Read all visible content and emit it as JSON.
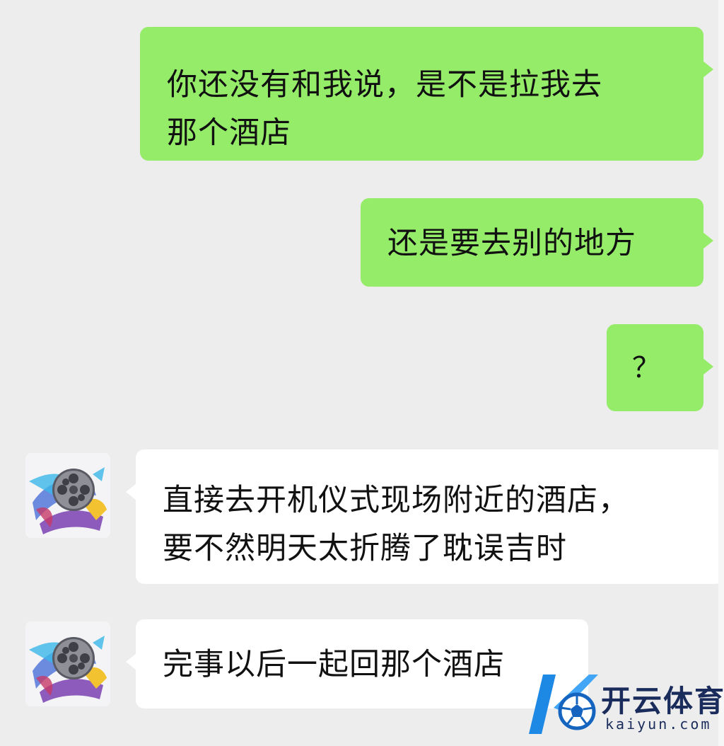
{
  "messages": [
    {
      "side": "sent",
      "lines": [
        "你还没有和我说，是不是拉我去",
        "那个酒店"
      ]
    },
    {
      "side": "sent",
      "lines": [
        "还是要去别的地方"
      ]
    },
    {
      "side": "sent",
      "lines": [
        "？"
      ]
    },
    {
      "side": "received",
      "lines": [
        "直接去开机仪式现场附近的酒店，",
        "要不然明天太折腾了耽误吉时"
      ]
    },
    {
      "side": "received",
      "lines": [
        "完事以后一起回那个酒店"
      ]
    }
  ],
  "watermark": {
    "title": "开云体育",
    "url": "kaiyun.com"
  },
  "colors": {
    "background": "#ededed",
    "sent_bubble": "#95ec69",
    "received_bubble": "#ffffff",
    "watermark_text": "#1a2c5c",
    "watermark_accent": "#1e88e5"
  },
  "icons": {
    "avatar": "film-reel-avatar-icon",
    "watermark_logo": "soccer-ball-k-logo-icon"
  }
}
